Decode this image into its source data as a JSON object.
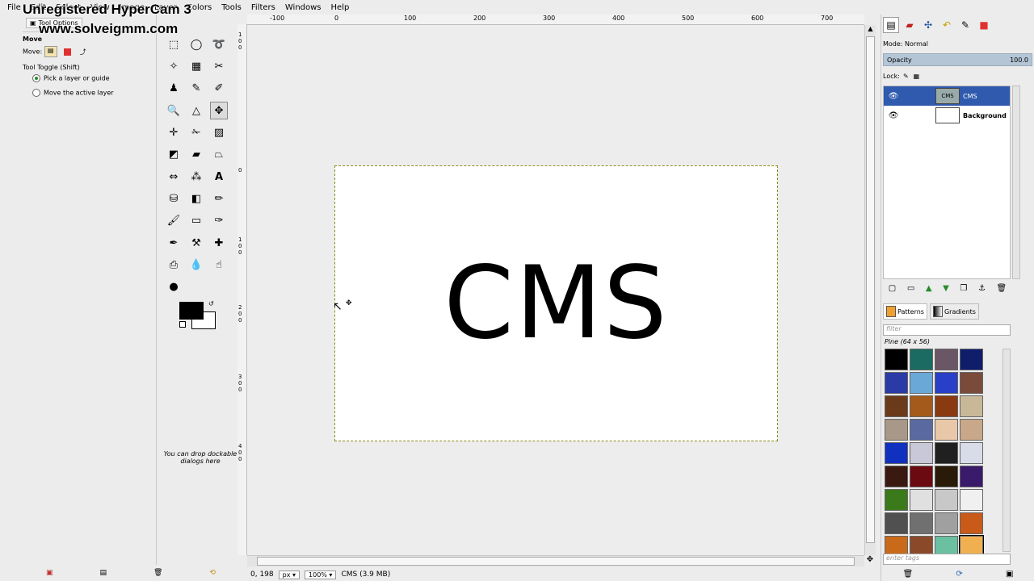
{
  "watermark": {
    "line1": "Unregistered HyperCam 3",
    "line2": "www.solveigmm.com"
  },
  "menu": [
    "File",
    "Edit",
    "Select",
    "View",
    "Image",
    "Layer",
    "Colors",
    "Tools",
    "Filters",
    "Windows",
    "Help"
  ],
  "tool_options": {
    "tab_label": "Tool Options",
    "tool_name": "Move",
    "move_label": "Move:",
    "toggle_label": "Tool Toggle  (Shift)",
    "options": [
      {
        "label": "Pick a layer or guide",
        "selected": true
      },
      {
        "label": "Move the active layer",
        "selected": false
      }
    ]
  },
  "toolbox": {
    "drop_hint": "You can drop dockable dialogs here",
    "active_tool": "move-tool",
    "fg_color": "#000000",
    "bg_color": "#ffffff"
  },
  "ruler": {
    "h_labels": [
      "-100",
      "0",
      "100",
      "200",
      "300",
      "400",
      "500",
      "600",
      "700"
    ],
    "v_labels": [
      "1",
      "0",
      "0",
      "0",
      "1",
      "0",
      "0",
      "2",
      "0",
      "0",
      "3",
      "0",
      "0",
      "4",
      "0",
      "0"
    ]
  },
  "canvas": {
    "text": "CMS"
  },
  "status": {
    "coords": "0, 198",
    "unit": "px",
    "zoom": "100%",
    "info": "CMS (3.9 MB)"
  },
  "layers_panel": {
    "mode": "Mode: Normal",
    "opacity_label": "Opacity",
    "opacity_value": "100.0",
    "lock_label": "Lock:",
    "layers": [
      {
        "name": "CMS",
        "selected": true,
        "thumb": "CMS"
      },
      {
        "name": "Background",
        "selected": false,
        "thumb": ""
      }
    ]
  },
  "patterns_panel": {
    "tabs": [
      "Patterns",
      "Gradients"
    ],
    "filter_placeholder": "filter",
    "pattern_name": "Pine (64 x 56)",
    "tags_placeholder": "enter tags",
    "colors": [
      "#000000",
      "#1c6b62",
      "#6b5666",
      "#0f1d6b",
      "#2a3aa6",
      "#6aa8d8",
      "#2a3fc8",
      "#7a4a3a",
      "#6b3a1a",
      "#a45a1a",
      "#8a3a10",
      "#c8b898",
      "#a89888",
      "#5a6aa0",
      "#e8c8a8",
      "#c8a888",
      "#1030c0",
      "#c8c8d8",
      "#202020",
      "#d8dce8",
      "#3a1a10",
      "#6b0a10",
      "#2a1a08",
      "#3a1a6b",
      "#3a7a1a",
      "#e0e0e0",
      "#c8c8c8",
      "#f0f0f0",
      "#505050",
      "#707070",
      "#a0a0a0",
      "#c85a1a",
      "#c86a1a",
      "#8a4a2a",
      "#6ac0a0",
      "#f0b050"
    ]
  }
}
